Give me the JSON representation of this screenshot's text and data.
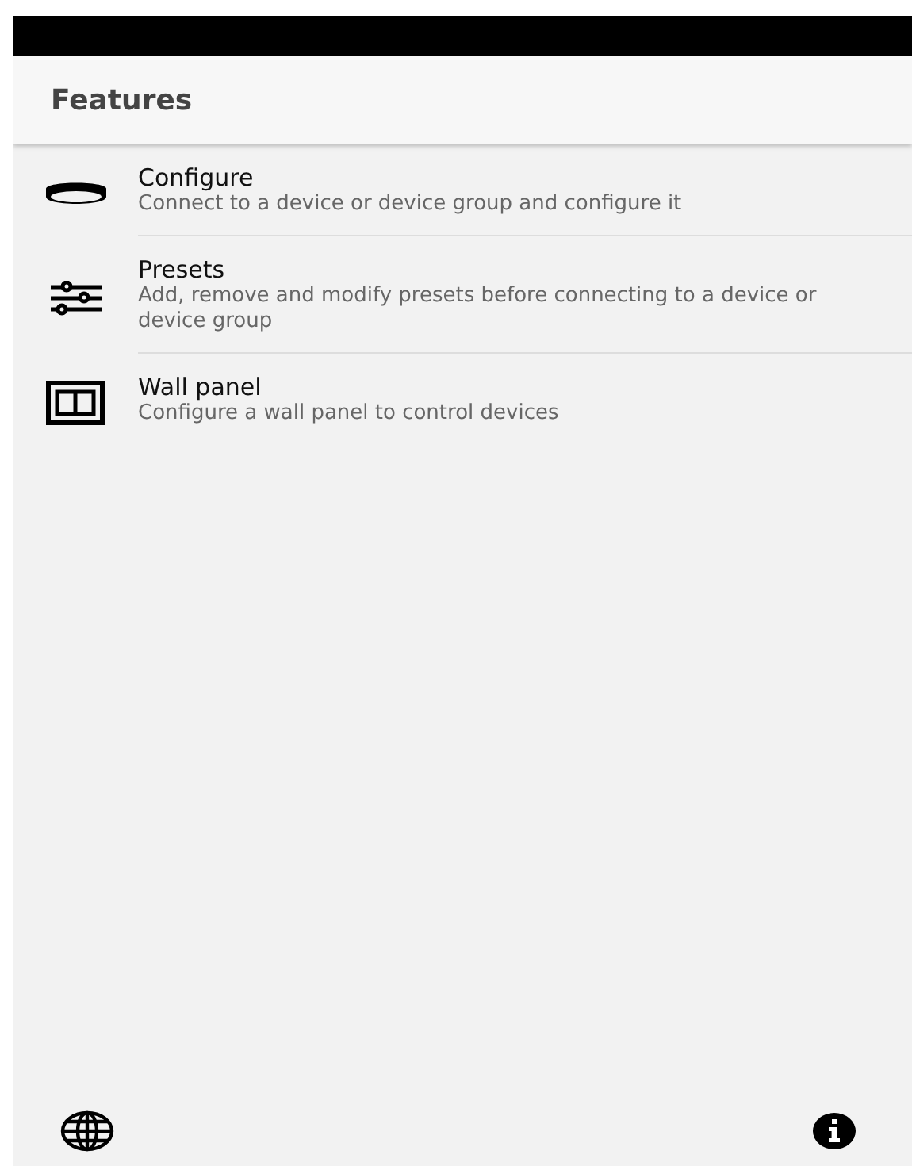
{
  "header": {
    "title": "Features"
  },
  "features": [
    {
      "title": "Configure",
      "description": "Connect to a device or device group and configure it"
    },
    {
      "title": "Presets",
      "description": "Add, remove and modify presets before connecting to a device or device group"
    },
    {
      "title": "Wall panel",
      "description": "Configure a wall panel to control devices"
    }
  ]
}
